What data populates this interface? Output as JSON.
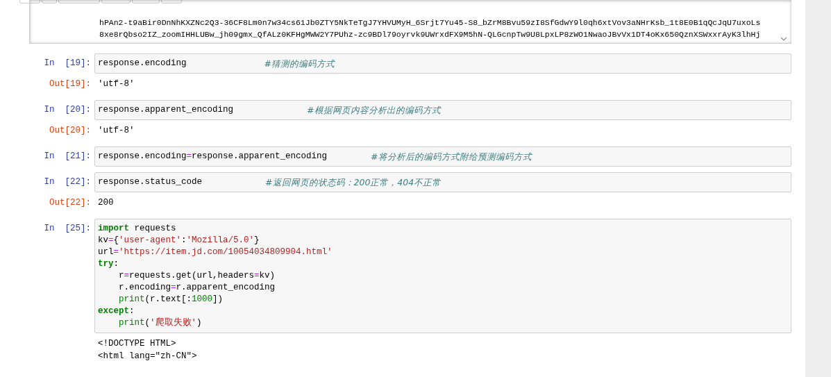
{
  "top_output": {
    "lines": [
      "hPAn2-t9aBir0DnNhKXZNc2Q3-36CF8Lm0n7w34cs61Jb0ZTY5NkTeTgJ7YHVUMyH_6Srjt7Yu45-S8_bZrM8Bvu59zI8SfGdwY9l0qh6xtVov3aNHrKsb_1t8E0B1qQcJqU7uxoLs",
      "8xe8rQbso2IZ_zoomIHHLUBw_jh09gmx_QfALz0KFHgMWW2Y7PUhz-zc9BDl79oyrvk9UWrxdFX9M5hN-QLGcnpTw9U8LpxLP8zWO1NwaoJBvVx1DT4oKx650QznXSWxxrAyK3lhHj"
    ]
  },
  "cells": [
    {
      "in_prompt": "In  [19]:",
      "lines": [
        {
          "tokens": [
            {
              "kind": "name",
              "text": "response.encoding"
            }
          ],
          "comment": "#猜测的编码方式"
        }
      ],
      "out_prompt": "Out[19]:",
      "output": [
        "'utf-8'"
      ]
    },
    {
      "in_prompt": "In  [20]:",
      "lines": [
        {
          "tokens": [
            {
              "kind": "name",
              "text": "response.apparent_encoding"
            }
          ],
          "comment": "#根据网页内容分析出的编码方式"
        }
      ],
      "out_prompt": "Out[20]:",
      "output": [
        "'utf-8'"
      ]
    },
    {
      "in_prompt": "In  [21]:",
      "lines": [
        {
          "tokens": [
            {
              "kind": "name",
              "text": "response.encoding"
            },
            {
              "kind": "op",
              "text": "="
            },
            {
              "kind": "name",
              "text": "response.apparent_encoding"
            }
          ],
          "comment": "#将分析后的编码方式附给预测编码方式"
        }
      ]
    },
    {
      "in_prompt": "In  [22]:",
      "lines": [
        {
          "tokens": [
            {
              "kind": "name",
              "text": "response.status_code"
            }
          ],
          "comment": "#返回网页的状态码：200正常，404不正常"
        }
      ],
      "out_prompt": "Out[22]:",
      "output": [
        "200"
      ]
    },
    {
      "in_prompt": "In  [25]:",
      "lines": [
        {
          "tokens": [
            {
              "kind": "keyword",
              "text": "import"
            },
            {
              "kind": "name",
              "text": " requests"
            }
          ]
        },
        {
          "tokens": [
            {
              "kind": "name",
              "text": "kv"
            },
            {
              "kind": "op",
              "text": "="
            },
            {
              "kind": "name",
              "text": "{"
            },
            {
              "kind": "string",
              "text": "'user-agent'"
            },
            {
              "kind": "name",
              "text": ":"
            },
            {
              "kind": "string",
              "text": "'Mozilla/5.0'"
            },
            {
              "kind": "name",
              "text": "}"
            }
          ]
        },
        {
          "tokens": [
            {
              "kind": "name",
              "text": "url"
            },
            {
              "kind": "op",
              "text": "="
            },
            {
              "kind": "string",
              "text": "'https://item.jd.com/10054034809904.html'"
            }
          ]
        },
        {
          "tokens": [
            {
              "kind": "keyword",
              "text": "try"
            },
            {
              "kind": "name",
              "text": ":"
            }
          ]
        },
        {
          "tokens": [
            {
              "kind": "name",
              "text": "    r"
            },
            {
              "kind": "op",
              "text": "="
            },
            {
              "kind": "name",
              "text": "requests.get(url,headers"
            },
            {
              "kind": "op",
              "text": "="
            },
            {
              "kind": "name",
              "text": "kv)"
            }
          ]
        },
        {
          "tokens": [
            {
              "kind": "name",
              "text": "    r.encoding"
            },
            {
              "kind": "op",
              "text": "="
            },
            {
              "kind": "name",
              "text": "r.apparent_encoding"
            }
          ]
        },
        {
          "tokens": [
            {
              "kind": "builtin",
              "text": "    print"
            },
            {
              "kind": "name",
              "text": "(r.text[:"
            },
            {
              "kind": "number",
              "text": "1000"
            },
            {
              "kind": "name",
              "text": "])"
            }
          ]
        },
        {
          "tokens": [
            {
              "kind": "keyword",
              "text": "except"
            },
            {
              "kind": "name",
              "text": ":"
            }
          ]
        },
        {
          "tokens": [
            {
              "kind": "builtin",
              "text": "    print"
            },
            {
              "kind": "name",
              "text": "("
            },
            {
              "kind": "string",
              "text": "'爬取失败'"
            },
            {
              "kind": "name",
              "text": ")"
            }
          ]
        }
      ],
      "output": [
        "<!DOCTYPE HTML>",
        "<html lang=\"zh-CN\">"
      ]
    }
  ]
}
